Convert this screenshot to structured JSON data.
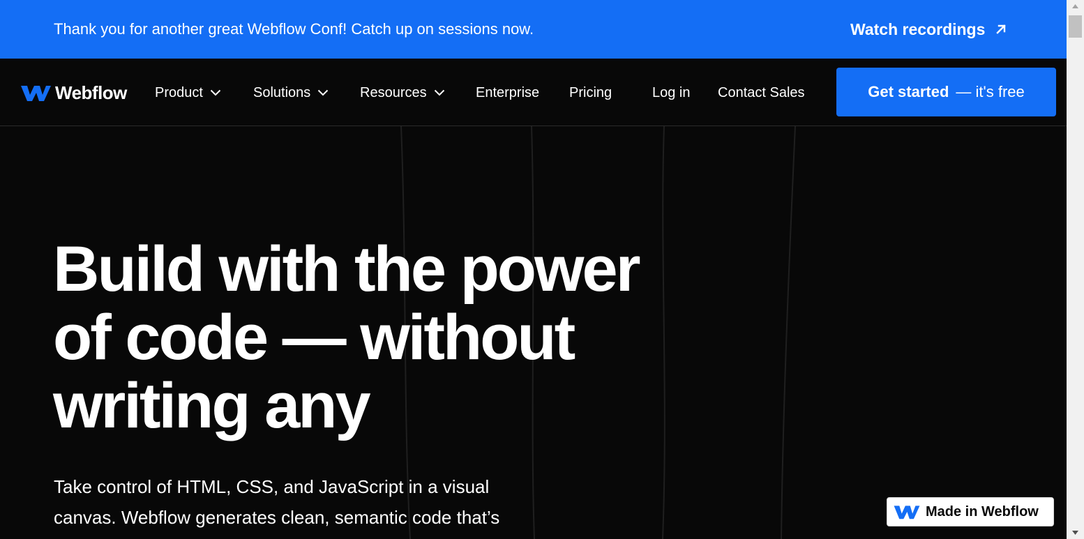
{
  "announcement": {
    "text": "Thank you for another great Webflow Conf! Catch up on sessions now.",
    "link_label": "Watch recordings"
  },
  "nav": {
    "logo_text": "Webflow",
    "items": [
      {
        "label": "Product",
        "has_dropdown": true
      },
      {
        "label": "Solutions",
        "has_dropdown": true
      },
      {
        "label": "Resources",
        "has_dropdown": true
      },
      {
        "label": "Enterprise",
        "has_dropdown": false
      },
      {
        "label": "Pricing",
        "has_dropdown": false
      }
    ],
    "login_label": "Log in",
    "contact_label": "Contact Sales",
    "cta_bold": "Get started",
    "cta_rest": "— it's free"
  },
  "hero": {
    "title_lines": [
      "Build with the power",
      "of code — without",
      "writing any"
    ],
    "subtitle_lines": [
      "Take control of HTML, CSS, and JavaScript in a visual",
      "canvas. Webflow generates clean, semantic code that’s"
    ]
  },
  "badge": {
    "label": "Made in Webflow"
  },
  "colors": {
    "brand_blue": "#146ef5",
    "background": "#080808",
    "text": "#ffffff"
  },
  "icons": {
    "logo": "webflow-logo-icon",
    "external_link": "arrow-up-right-icon",
    "dropdown": "chevron-down-icon"
  }
}
